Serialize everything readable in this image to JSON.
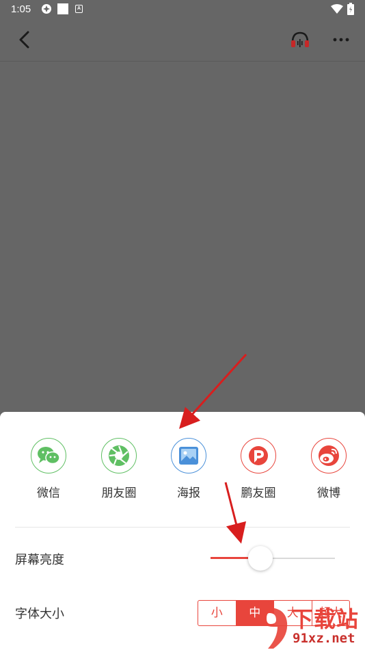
{
  "status_bar": {
    "time": "1:05",
    "a_badge": "A"
  },
  "app_bar": {
    "icons": [
      "back-icon",
      "headphone-icon",
      "more-icon"
    ]
  },
  "share_options": [
    {
      "label": "微信",
      "icon": "wechat-icon",
      "color": "#5fbf63"
    },
    {
      "label": "朋友圈",
      "icon": "moments-icon",
      "color": "#5fbf63"
    },
    {
      "label": "海报",
      "icon": "poster-icon",
      "color": "#4a90d9"
    },
    {
      "label": "鹏友圈",
      "icon": "pengyouquan-icon",
      "color": "#e8453c"
    },
    {
      "label": "微博",
      "icon": "weibo-icon",
      "color": "#e8453c"
    }
  ],
  "settings": {
    "brightness_label": "屏幕亮度",
    "brightness_level": 0.4,
    "font_size_label": "字体大小",
    "font_size_options": [
      "小",
      "中",
      "大",
      "超大"
    ],
    "font_size_selected": "中"
  },
  "watermark": {
    "title": "下载站",
    "url": "91xz.net"
  },
  "colors": {
    "accent": "#e8453c",
    "overlay": "#666666",
    "sheet": "#ffffff",
    "wechat_green": "#5fbf63",
    "poster_blue": "#4a90d9"
  }
}
